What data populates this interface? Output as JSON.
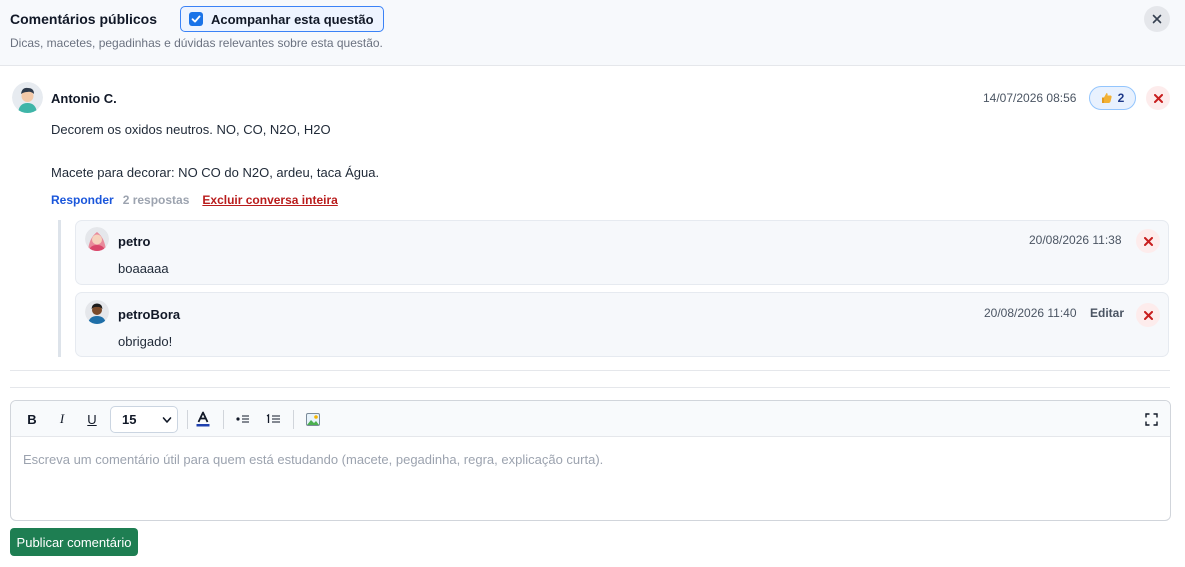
{
  "header": {
    "title": "Comentários públicos",
    "follow_label": "Acompanhar esta questão",
    "follow_checked": true,
    "subtitle": "Dicas, macetes, pegadinhas e dúvidas relevantes sobre esta questão."
  },
  "comment": {
    "author": "Antonio C.",
    "timestamp": "14/07/2026 08:56",
    "likes": "2",
    "lines": [
      "Decorem os oxidos neutros. NO, CO, N2O, H2O",
      "Macete para decorar: NO CO do N2O, ardeu, taca Água."
    ],
    "actions": {
      "reply": "Responder",
      "replies_count": "2 respostas",
      "delete_thread": "Excluir conversa inteira"
    }
  },
  "replies": [
    {
      "author": "petro",
      "timestamp": "20/08/2026 11:38",
      "text": "boaaaaa"
    },
    {
      "author": "petroBora",
      "timestamp": "20/08/2026 11:40",
      "edit_label": "Editar",
      "text": "obrigado!"
    }
  ],
  "editor": {
    "font_size": "15",
    "placeholder": "Escreva um comentário útil para quem está estudando (macete, pegadinha, regra, explicação curta)."
  },
  "submit_label": "Publicar comentário",
  "colors": {
    "accent_blue": "#1a73e8",
    "link_blue": "#1a56db",
    "danger_red": "#b91c1c",
    "submit_green": "#1e7e52"
  },
  "icons": {
    "close": "close-icon",
    "like": "thumbs-up-icon",
    "delete": "delete-x-icon",
    "bold": "bold-icon",
    "italic": "italic-icon",
    "underline": "underline-icon",
    "text_color": "text-color-icon",
    "bullet_list": "bullet-list-icon",
    "numbered_list": "numbered-list-icon",
    "image": "image-icon",
    "fullscreen": "fullscreen-icon"
  }
}
